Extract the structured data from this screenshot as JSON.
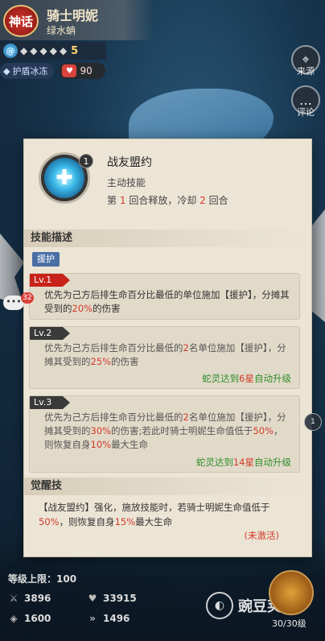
{
  "hero": {
    "rank_badge": "神话",
    "name": "骑士明妮",
    "sub": "绿水蚺",
    "stars": 5,
    "star_count": "5",
    "element_icon": "water-swirl-icon",
    "shield_tag": "护盾冰冻",
    "likes": "90"
  },
  "side": {
    "source_label": "来源",
    "comment_label": "评论"
  },
  "skill": {
    "count": "1",
    "name": "战友盟约",
    "type": "主动技能",
    "cd_prefix": "第",
    "cd_round": "1",
    "cd_mid": "回合释放，冷却",
    "cd_val": "2",
    "cd_suffix": "回合",
    "desc_header": "技能描述",
    "tag": "援护"
  },
  "levels": [
    {
      "label": "Lv.1",
      "text_a": "优先为己方后排生命百分比最低的单位施加【援护】，分摊其受到的",
      "pct": "20%",
      "text_b": "的伤害"
    },
    {
      "label": "Lv.2",
      "text_a": "优先为己方后排生命百分比最低的",
      "num": "2",
      "text_b": "名单位施加【援护】，分摊其受到的",
      "pct": "25%",
      "text_c": "的伤害",
      "upgrade_a": "蛇灵达到",
      "upgrade_star": "6星",
      "upgrade_b": "自动升级"
    },
    {
      "label": "Lv.3",
      "text_a": "优先为己方后排生命百分比最低的",
      "num": "2",
      "text_b": "名单位施加【援护】，分摊其受到的",
      "pct": "30%",
      "text_c": "的伤害;若此时骑士明妮生命值低于",
      "pct2": "50%",
      "text_d": "，则恢复自身",
      "pct3": "10%",
      "text_e": "最大生命",
      "upgrade_a": "蛇灵达到",
      "upgrade_star": "14星",
      "upgrade_b": "自动升级"
    }
  ],
  "awaken": {
    "header": "觉醒技",
    "text_a": "【战友盟约】强化，施放技能时，若骑士明妮生命值低于",
    "pct": "50%",
    "text_b": "，则恢复自身",
    "pct2": "15%",
    "text_c": "最大生命",
    "status": "(未激活)"
  },
  "chat": {
    "count": "32"
  },
  "right_badge": "1",
  "stats": {
    "level_cap": "等级上限：100",
    "attack": "3896",
    "hp": "33915",
    "defense": "1600",
    "speed": "1496"
  },
  "progress": "30/30级",
  "watermark": "豌豆荚"
}
